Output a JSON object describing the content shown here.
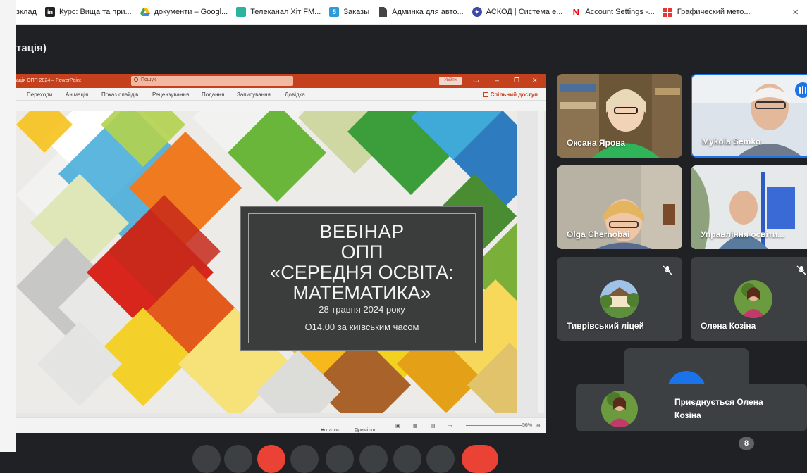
{
  "bookmarks": [
    {
      "label": "зклад",
      "icon": "none",
      "color": ""
    },
    {
      "label": "Курс: Вища та при...",
      "icon": "in-logo-icon",
      "color": "#222222"
    },
    {
      "label": "документи – Googl...",
      "icon": "google-drive-icon",
      "color": "#1a73e8"
    },
    {
      "label": "Телеканал Хіт FM...",
      "icon": "tv-icon",
      "color": "#2bb3a0"
    },
    {
      "label": "Заказы",
      "icon": "five-icon",
      "color": "#2e9bd6"
    },
    {
      "label": "Админка для авто...",
      "icon": "document-icon",
      "color": "#444444"
    },
    {
      "label": "АСКОД | Система е...",
      "icon": "compass-icon",
      "color": "#3c4aa8"
    },
    {
      "label": "Account Settings -...",
      "icon": "netflix-icon",
      "color": "#e50914"
    },
    {
      "label": "Графический мето...",
      "icon": "grid-icon",
      "color": "#e53935"
    }
  ],
  "bookmarks_close": "×",
  "meeting": {
    "title": "тація)"
  },
  "ppt": {
    "doc_title": "ація ОПП 2024 – PowerPoint",
    "search_placeholder": "Пошук",
    "login_label": "Увійти",
    "tabs": [
      "Переходи",
      "Анімація",
      "Показ слайдів",
      "Рецензування",
      "Подання",
      "Записування",
      "Довідка"
    ],
    "share_label": "Спільний доступ",
    "status_notes": "Нотатки",
    "status_comments": "Примітки",
    "zoom": "56%"
  },
  "slide": {
    "line1": "ВЕБІНАР",
    "line2": "ОПП",
    "line3": "«СЕРЕДНЯ ОСВІТА:",
    "line4": "МАТЕМАТИКА»",
    "date": "28 травня 2024 року",
    "time": "О14.00 за київським часом"
  },
  "participants": [
    {
      "name": "Оксана Ярова",
      "muted": false,
      "speaking": false
    },
    {
      "name": "Mykola Semko",
      "muted": false,
      "speaking": true
    },
    {
      "name": "Olga Chernobai",
      "muted": false,
      "speaking": false
    },
    {
      "name": "Управління освіти...",
      "muted": false,
      "speaking": false
    },
    {
      "name": "Тиврівський ліцей",
      "muted": true,
      "speaking": false
    },
    {
      "name": "Олена Козіна",
      "muted": true,
      "speaking": false
    }
  ],
  "toast": {
    "line1": "Приєднується Олена",
    "line2": "Козіна"
  },
  "participant_count": "8",
  "colors": {
    "accent": "#1a73e8",
    "ppt": "#c5401c",
    "tile": "#3c4043",
    "bg": "#202124"
  }
}
